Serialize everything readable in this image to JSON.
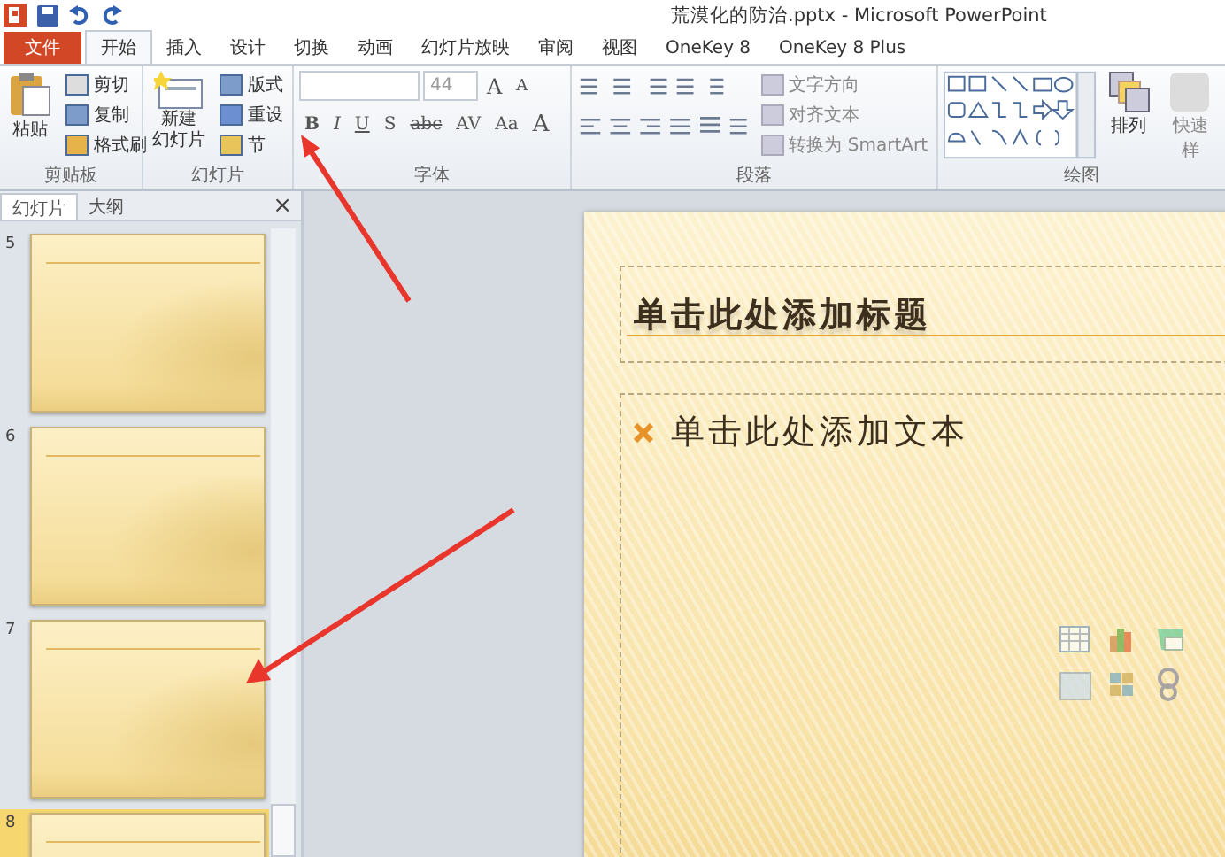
{
  "window": {
    "title": "荒漠化的防治.pptx - Microsoft PowerPoint"
  },
  "tabs": [
    {
      "label": "文件",
      "kind": "file",
      "selected": false
    },
    {
      "label": "开始",
      "kind": "tab",
      "selected": true
    },
    {
      "label": "插入",
      "kind": "tab",
      "selected": false
    },
    {
      "label": "设计",
      "kind": "tab",
      "selected": false
    },
    {
      "label": "切换",
      "kind": "tab",
      "selected": false
    },
    {
      "label": "动画",
      "kind": "tab",
      "selected": false
    },
    {
      "label": "幻灯片放映",
      "kind": "tab",
      "selected": false
    },
    {
      "label": "审阅",
      "kind": "tab",
      "selected": false
    },
    {
      "label": "视图",
      "kind": "tab",
      "selected": false
    },
    {
      "label": "OneKey 8",
      "kind": "tab",
      "selected": false
    },
    {
      "label": "OneKey 8 Plus",
      "kind": "tab",
      "selected": false
    }
  ],
  "ribbon": {
    "clipboard": {
      "name": "剪贴板",
      "paste": "粘贴",
      "items": [
        "剪切",
        "复制",
        "格式刷"
      ]
    },
    "slides": {
      "name": "幻灯片",
      "new_slide": [
        "新建",
        "幻灯片"
      ],
      "items": [
        "版式",
        "重设",
        "节"
      ]
    },
    "font": {
      "name": "字体",
      "size": "44",
      "grow_shrink": [
        "A",
        "A"
      ],
      "format_buttons": [
        "B",
        "I",
        "U",
        "S",
        "abc",
        "AV",
        "Aa"
      ],
      "color_button": "A"
    },
    "paragraph": {
      "name": "段落",
      "items": [
        "文字方向",
        "对齐文本",
        "转换为 SmartArt"
      ]
    },
    "drawing": {
      "name": "绘图",
      "arrange": "排列",
      "quick_styles": "快速样"
    }
  },
  "panel": {
    "tabs": [
      {
        "label": "幻灯片",
        "selected": true
      },
      {
        "label": "大纲",
        "selected": false
      }
    ],
    "close": "×",
    "thumbnails": [
      {
        "number": "5",
        "selected": false
      },
      {
        "number": "6",
        "selected": false
      },
      {
        "number": "7",
        "selected": false
      },
      {
        "number": "8",
        "selected": true
      }
    ]
  },
  "slide": {
    "title_placeholder": "单击此处添加标题",
    "body_placeholder": "单击此处添加文本"
  }
}
